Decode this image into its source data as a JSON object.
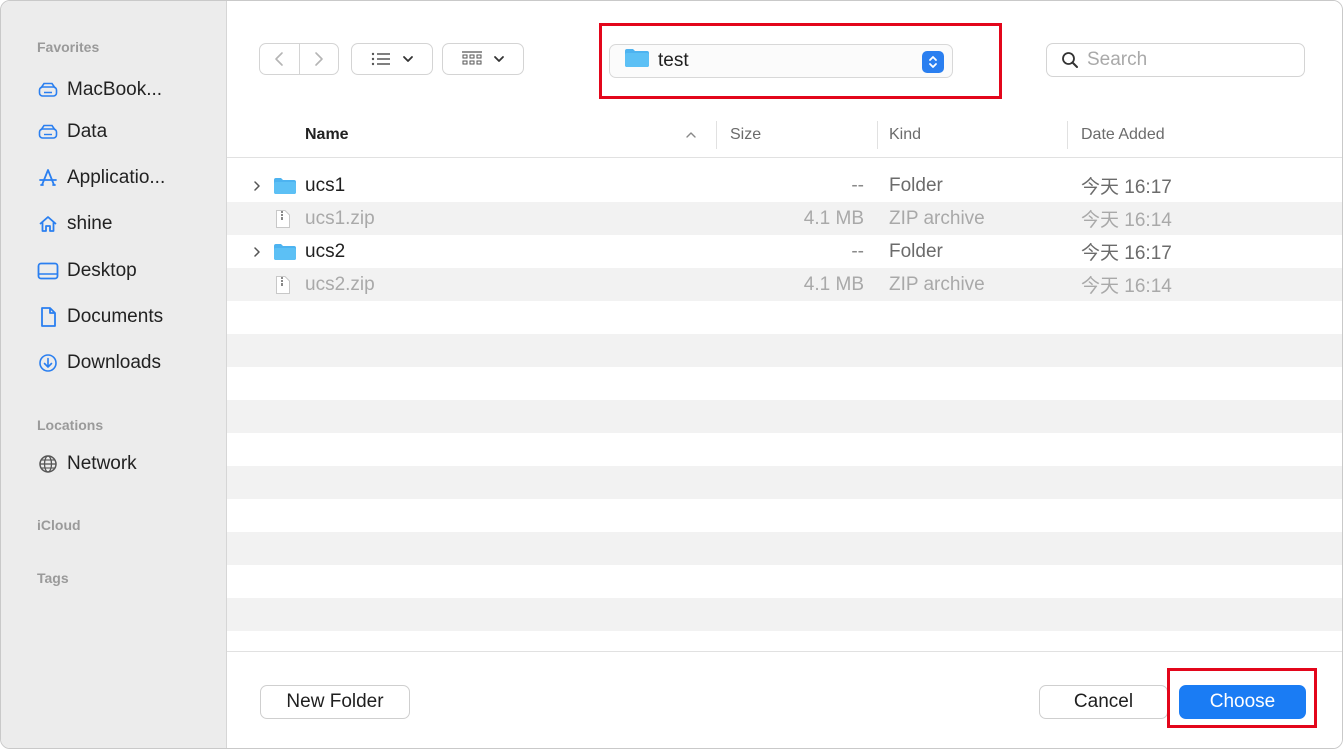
{
  "sidebar": {
    "sections": {
      "favorites": "Favorites",
      "locations": "Locations",
      "icloud": "iCloud",
      "tags": "Tags"
    },
    "favorites": [
      {
        "label": "MacBook...",
        "icon": "drive-icon"
      },
      {
        "label": "Data",
        "icon": "drive-icon"
      },
      {
        "label": "Applicatio...",
        "icon": "applications-icon"
      },
      {
        "label": "shine",
        "icon": "home-icon"
      },
      {
        "label": "Desktop",
        "icon": "desktop-icon"
      },
      {
        "label": "Documents",
        "icon": "document-icon"
      },
      {
        "label": "Downloads",
        "icon": "download-icon"
      }
    ],
    "locations": [
      {
        "label": "Network",
        "icon": "globe-icon"
      }
    ]
  },
  "toolbar": {
    "path_value": "test",
    "search_placeholder": "Search"
  },
  "table": {
    "headers": {
      "name": "Name",
      "size": "Size",
      "kind": "Kind",
      "date": "Date Added"
    },
    "rows": [
      {
        "name": "ucs1",
        "size": "--",
        "kind": "Folder",
        "date": "今天 16:17",
        "type": "folder",
        "disabled": false
      },
      {
        "name": "ucs1.zip",
        "size": "4.1 MB",
        "kind": "ZIP archive",
        "date": "今天 16:14",
        "type": "zip",
        "disabled": true
      },
      {
        "name": "ucs2",
        "size": "--",
        "kind": "Folder",
        "date": "今天 16:17",
        "type": "folder",
        "disabled": false
      },
      {
        "name": "ucs2.zip",
        "size": "4.1 MB",
        "kind": "ZIP archive",
        "date": "今天 16:14",
        "type": "zip",
        "disabled": true
      }
    ]
  },
  "footer": {
    "new_folder": "New Folder",
    "cancel": "Cancel",
    "choose": "Choose"
  },
  "colors": {
    "accent": "#1a7cf4",
    "highlight": "#e3061b",
    "folder": "#4db3f0"
  }
}
